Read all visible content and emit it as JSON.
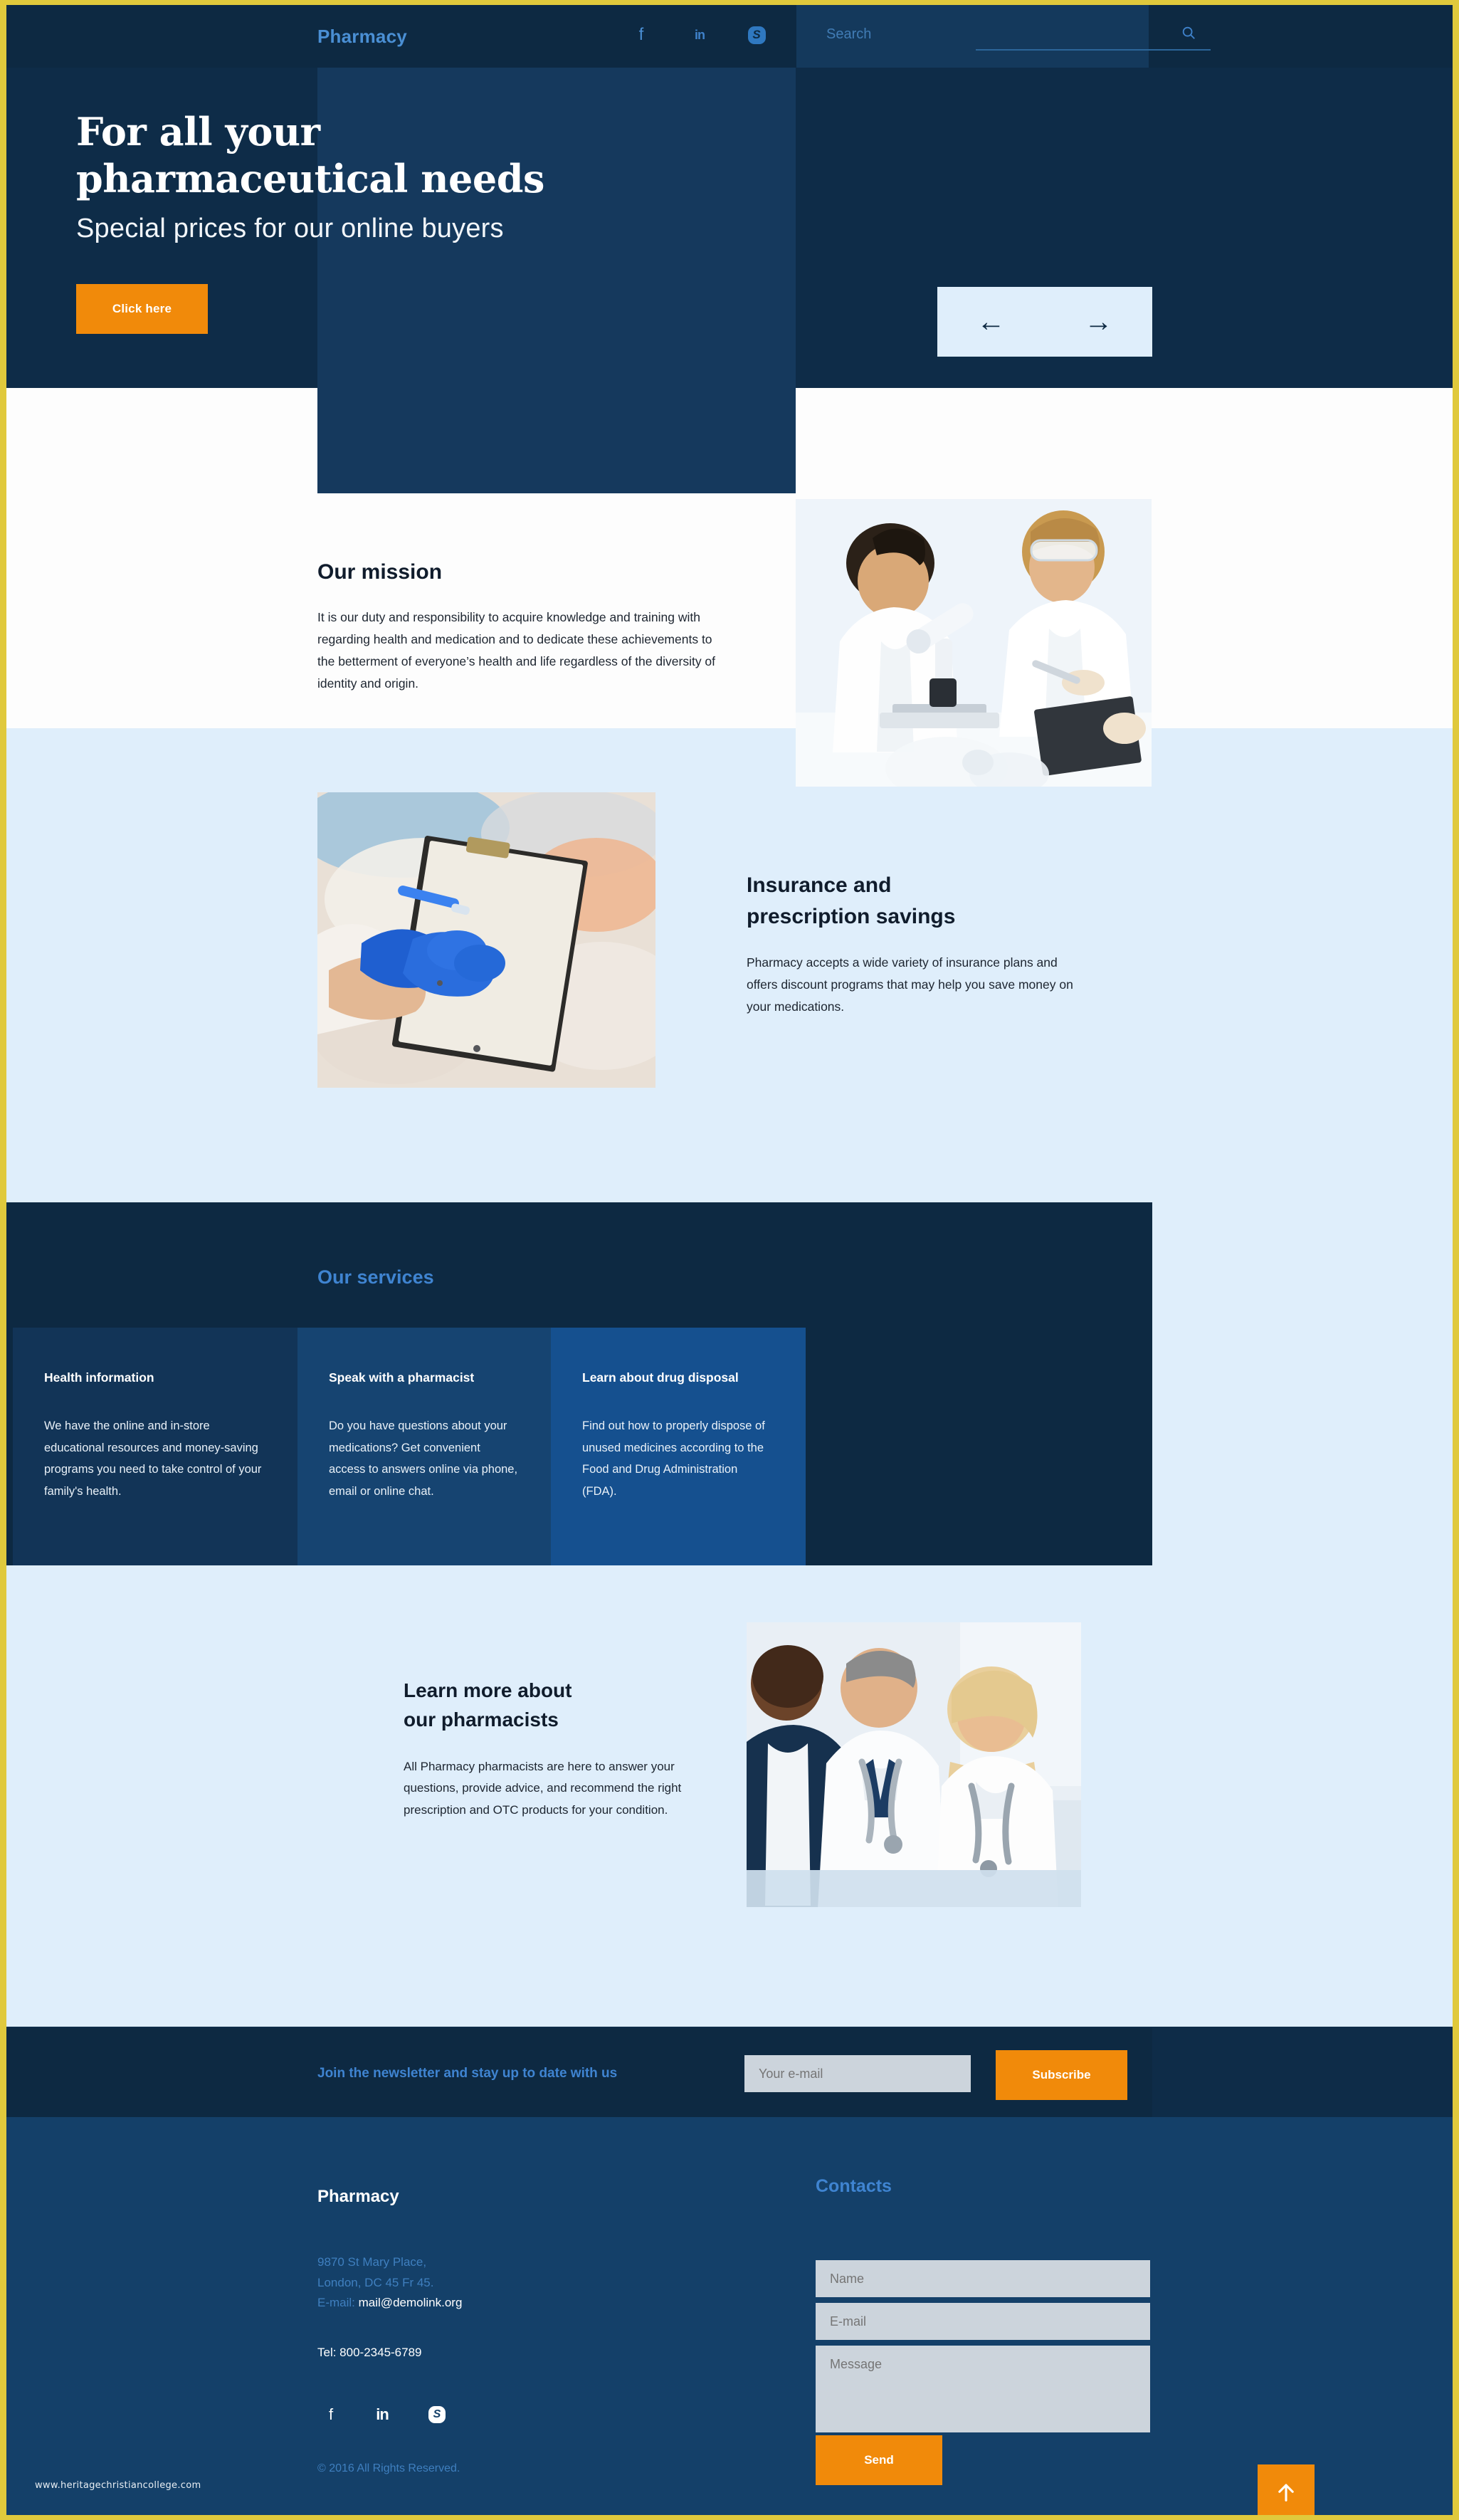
{
  "theme": {
    "border_gold": "#e0c93c",
    "dark_navy": "#0d2942",
    "panel_navy": "#15395d",
    "footer_navy": "#144069",
    "accent_blue": "#3f84d1",
    "accent_orange": "#f18a0a",
    "light_blue": "#dfeefb"
  },
  "header": {
    "logo": "Pharmacy",
    "social": [
      {
        "name": "facebook",
        "glyph": "f"
      },
      {
        "name": "linkedin",
        "glyph": "in"
      },
      {
        "name": "skype",
        "glyph": "S"
      }
    ],
    "search": {
      "label": "Search",
      "value": "",
      "placeholder": "",
      "icon": "search-icon"
    }
  },
  "hero": {
    "title_line1": "For all your",
    "title_line2": "pharmaceutical needs",
    "subtitle": "Special prices for our online buyers",
    "button": "Click here",
    "prev_arrow": "←",
    "next_arrow": "→"
  },
  "mission": {
    "title": "Our mission",
    "text": "It is our duty and responsibility to acquire knowledge and training with regarding health and medication and to dedicate these achievements to the betterment of everyone’s health and life regardless of the diversity of identity and origin.",
    "image_alt": "lab-researchers-microscope-photo"
  },
  "insurance": {
    "title_line1": "Insurance and",
    "title_line2": "prescription savings",
    "text": "Pharmacy accepts a wide variety of insurance plans and offers discount programs that may help you save money on your medications.",
    "image_alt": "gloved-hand-writing-on-clipboard-photo"
  },
  "services": {
    "title": "Our services",
    "cards": [
      {
        "heading": "Health information",
        "body": "We have the online and in-store educational resources and money-saving programs you need to take control of your family's health."
      },
      {
        "heading": "Speak with a pharmacist",
        "body": "Do you have questions about your medications? Get convenient access to answers online via phone, email or online chat."
      },
      {
        "heading": "Learn about drug disposal",
        "body": "Find out how to properly dispose of unused medicines according to the Food and Drug Administration (FDA)."
      }
    ]
  },
  "pharmacists": {
    "title_line1": "Learn more about",
    "title_line2": "our pharmacists",
    "text": "All Pharmacy pharmacists are here to answer your questions, provide advice, and recommend the right prescription and OTC products for your condition.",
    "image_alt": "three-pharmacists-talking-photo"
  },
  "newsletter": {
    "text": "Join the newsletter and stay up to date with us",
    "input_placeholder": "Your e-mail",
    "input_value": "",
    "button": "Subscribe"
  },
  "footer": {
    "logo": "Pharmacy",
    "address_line1": "9870 St Mary Place,",
    "address_line2": "London, DC 45 Fr 45.",
    "email_label": "E-mail:",
    "email": "mail@demolink.org",
    "tel": "Tel: 800-2345-6789",
    "social": [
      {
        "name": "facebook",
        "glyph": "f"
      },
      {
        "name": "linkedin",
        "glyph": "in"
      },
      {
        "name": "skype",
        "glyph": "S"
      }
    ],
    "copyright": "© 2016 All Rights Reserved.",
    "contacts": {
      "title": "Contacts",
      "name_placeholder": "Name",
      "name_value": "",
      "email_placeholder": "E-mail",
      "email_value": "",
      "message_placeholder": "Message",
      "message_value": "",
      "send_button": "Send"
    }
  },
  "watermark": "www.heritagechristiancollege.com",
  "scroll_top": {
    "icon": "arrow-up-icon"
  }
}
